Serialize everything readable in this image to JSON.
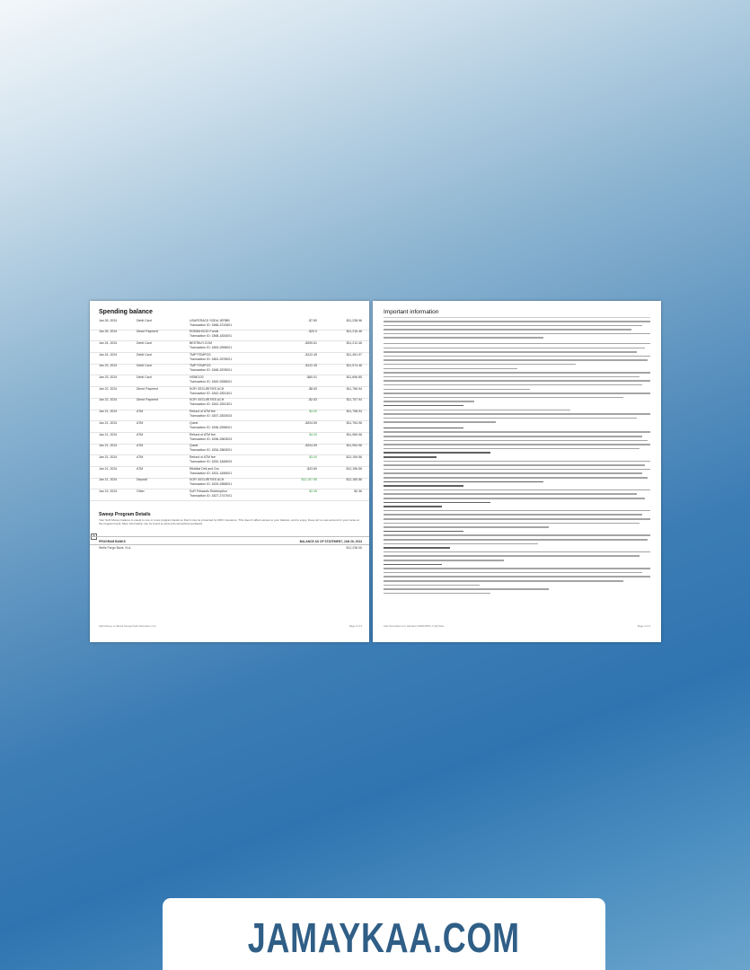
{
  "left_page": {
    "title": "Spending balance",
    "rows": [
      {
        "date": "Jan 26, 2024",
        "type": "Debit Card",
        "desc": "USAFERACK SODA 1ERBB",
        "txn": "Transaction ID: 1868-2210601",
        "amount": "-$7.80",
        "balance": "$11,238.96",
        "positive": false
      },
      {
        "date": "Jan 26, 2024",
        "type": "Direct Payment",
        "desc": "ROBINHOOD Funds",
        "txn": "Transaction ID: 1868-1834001",
        "amount": "-$20.0",
        "balance": "$11,216.46",
        "positive": false
      },
      {
        "date": "Jan 24, 2024",
        "type": "Debit Card",
        "desc": "BESTBUY.COM",
        "txn": "Transaction ID: 1863-2898001",
        "amount": "-$259.61",
        "balance": "$11,212.46",
        "positive": false
      },
      {
        "date": "Jan 24, 2024",
        "type": "Debit Card",
        "desc": "TMP*TEMPOS",
        "txn": "Transaction ID: 1861-2878001",
        "amount": "-$122.45",
        "balance": "$11,451.97",
        "positive": false
      },
      {
        "date": "Jan 23, 2024",
        "type": "Debit Card",
        "desc": "TMP*TEMPOS",
        "txn": "Transaction ID: 1848-2878001",
        "amount": "-$122.45",
        "balance": "$11,574.46",
        "positive": false
      },
      {
        "date": "Jan 23, 2024",
        "type": "Debit Card",
        "desc": "HSNE100",
        "txn": "Transaction ID: 1849-2838001",
        "amount": "-$60.01",
        "balance": "$11,696.85",
        "positive": false
      },
      {
        "date": "Jan 22, 2024",
        "type": "Direct Payment",
        "desc": "SOFI SECURITIES ACH",
        "txn": "Transaction ID: 1842-2831401",
        "amount": "-$8.63",
        "balance": "$11,756.94",
        "positive": false
      },
      {
        "date": "Jan 22, 2024",
        "type": "Direct Payment",
        "desc": "SOFI SECURITIES ACH",
        "txn": "Transaction ID: 1842-2831301",
        "amount": "-$2.63",
        "balance": "$11,757.94",
        "positive": false
      },
      {
        "date": "Jan 21, 2024",
        "type": "ATM",
        "desc": "Refund of ATM fee",
        "txn": "Transaction ID: 1837-2833003",
        "amount": "$4.00",
        "balance": "$11,758.94",
        "positive": true
      },
      {
        "date": "Jan 21, 2024",
        "type": "ATM",
        "desc": "Quest",
        "txn": "Transaction ID: 1836-2838001",
        "amount": "-$204.59",
        "balance": "$11,754.96",
        "positive": false
      },
      {
        "date": "Jan 21, 2024",
        "type": "ATM",
        "desc": "Refund of ATM fee",
        "txn": "Transaction ID: 1836-2863003",
        "amount": "$4.00",
        "balance": "$11,959.96",
        "positive": true
      },
      {
        "date": "Jan 21, 2024",
        "type": "ATM",
        "desc": "Quest",
        "txn": "Transaction ID: 1834-2863001",
        "amount": "-$204.59",
        "balance": "$11,954.96",
        "positive": false
      },
      {
        "date": "Jan 21, 2024",
        "type": "ATM",
        "desc": "Refund of ATM fee",
        "txn": "Transaction ID: 1832-1848003",
        "amount": "$3.00",
        "balance": "$12,159.56",
        "positive": true
      },
      {
        "date": "Jan 21, 2024",
        "type": "ATM",
        "desc": "Rifaiiliat Deli and Gro",
        "txn": "Transaction ID: 1831-1848001",
        "amount": "-$23.89",
        "balance": "$12,156.56",
        "positive": false
      },
      {
        "date": "Jan 21, 2024",
        "type": "Deposit",
        "desc": "SOFI SECURITIES ACH",
        "txn": "Transaction ID: 1829-2858001",
        "amount": "$12,157.55",
        "balance": "$12,180.56",
        "positive": true
      },
      {
        "date": "Jan 19, 2024",
        "type": "Other",
        "desc": "SoFi Rewards Redemption",
        "txn": "Transaction ID: 1827-2747001",
        "amount": "$2.05",
        "balance": "$2.36",
        "positive": true
      }
    ],
    "sweep": {
      "title": "Sweep Program Details",
      "text": "Your SoFi Money balance is swept to one or more program banks so that it may be protected by FDIC insurance. This doesn't affect access to your balance, and to enjoy, these isn't a new account in your name at the program bank. More information can be found at www.sofi.com/sofimoney/banks.",
      "col_bank": "PROGRAM BANKS",
      "col_balance": "BALANCE AS OF STATEMENT, JAN 26, 2024",
      "bank_name": "Wells Fargo Bank, N.A.",
      "bank_balance": "$12,238.06",
      "add_symbol": "+"
    },
    "footer_left": "SoFi Money is offered through SoFi Securities, LLC",
    "footer_right": "Page 3 of 4"
  },
  "right_page": {
    "title": "Important information",
    "footer_left": "SoFi Securities LLC, Member FINRA/SIPC, Fully Paid",
    "footer_right": "Page 4 of 4"
  },
  "banner": {
    "text": "JAMAYKAA.COM"
  },
  "colors": {
    "banner_text": "#2f5e86",
    "positive_amount": "#2f9a3c"
  }
}
